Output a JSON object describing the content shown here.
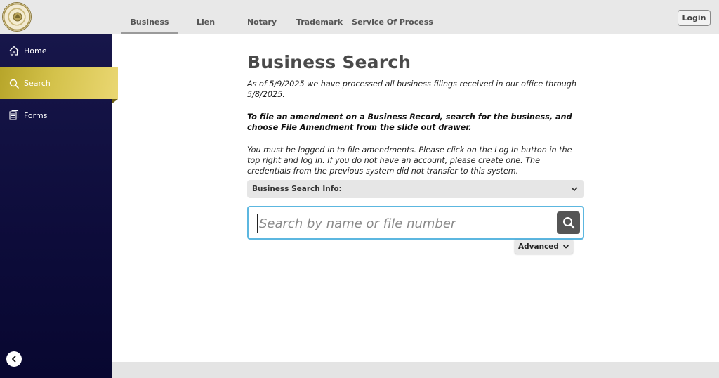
{
  "header": {
    "tabs": [
      {
        "label": "Business",
        "active": true
      },
      {
        "label": "Lien",
        "active": false
      },
      {
        "label": "Notary",
        "active": false
      },
      {
        "label": "Trademark",
        "active": false
      },
      {
        "label": "Service Of Process",
        "active": false
      }
    ],
    "login_label": "Login",
    "logo_icon": "state-seal-icon"
  },
  "sidebar": {
    "items": [
      {
        "label": "Home",
        "icon": "home-icon"
      },
      {
        "label": "Search",
        "icon": "search-icon",
        "active": true
      },
      {
        "label": "Forms",
        "icon": "document-icon"
      }
    ],
    "collapse_icon": "chevron-left-icon"
  },
  "main": {
    "title": "Business Search",
    "notice_processed": "As of 5/9/2025 we have processed all business filings received in our office through 5/8/2025.",
    "notice_amendment": "To file an amendment on a Business Record, search for the business, and choose File Amendment from the slide out drawer.",
    "notice_login": "You must be logged in to file amendments. Please click on the Log In button in the top right and log in. If you do not have an account, please create one. The credentials from the previous system did not transfer to this system.",
    "info_label": "Business Search Info:",
    "search": {
      "value": "",
      "placeholder": "Search by name or file number"
    },
    "advanced_label": "Advanced"
  },
  "colors": {
    "sidebar_bg": "#0d0c3a",
    "active_nav": "#d4c24b",
    "search_border": "#5cb7e0",
    "search_button": "#555555"
  }
}
